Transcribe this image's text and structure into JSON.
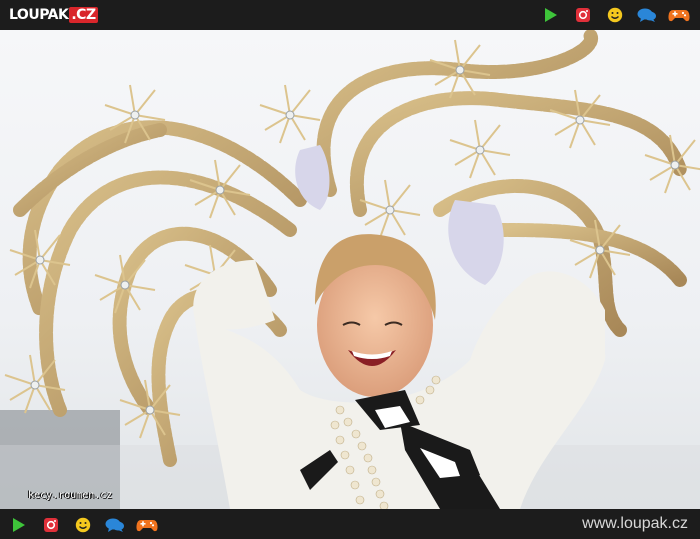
{
  "header": {
    "logo_main": "LOUPAK",
    "logo_tld": ".CZ",
    "icons": [
      "play-icon",
      "instagram-icon",
      "smiley-icon",
      "chat-icon",
      "gamepad-icon"
    ]
  },
  "photo": {
    "watermark": "kecy.roumen.cz"
  },
  "footer": {
    "icons": [
      "play-icon",
      "instagram-icon",
      "smiley-icon",
      "chat-icon",
      "gamepad-icon"
    ],
    "site_url": "www.loupak.cz"
  },
  "colors": {
    "bar_bg": "#1c1c1c",
    "play": "#3ec43a",
    "instagram": "#e0303a",
    "smiley": "#f4c81e",
    "chat": "#2a86d8",
    "gamepad": "#f0731e",
    "logo_accent": "#d9262b"
  }
}
